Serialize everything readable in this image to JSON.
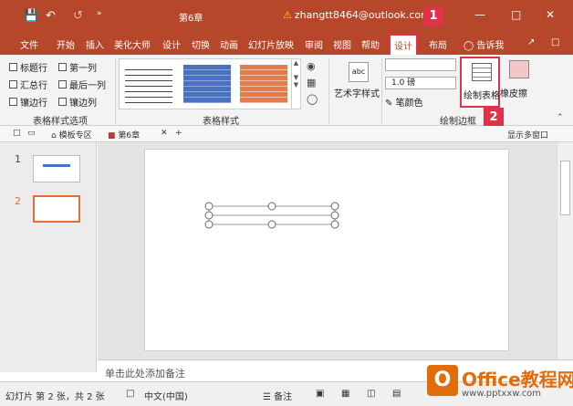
{
  "title_bar": {
    "doc_title": "第6章",
    "account": "zhangtt8464@outlook.com",
    "colors": {
      "accent": "#b7472a",
      "highlight": "#e0334a"
    }
  },
  "tabs": [
    {
      "label": "文件"
    },
    {
      "label": "开始"
    },
    {
      "label": "插入"
    },
    {
      "label": "美化大师"
    },
    {
      "label": "设计"
    },
    {
      "label": "切换"
    },
    {
      "label": "动画"
    },
    {
      "label": "幻灯片放映"
    },
    {
      "label": "审阅"
    },
    {
      "label": "视图"
    },
    {
      "label": "帮助"
    },
    {
      "label": "设计"
    },
    {
      "label": "布局"
    }
  ],
  "tell_me": "告诉我",
  "ribbon": {
    "options": [
      "标题行",
      "第一列",
      "汇总行",
      "最后一列",
      "镶边行",
      "镶边列"
    ],
    "group_options": "表格样式选项",
    "group_styles": "表格样式",
    "wordart": "艺术字样式",
    "pen_weight": "1.0 磅",
    "pen_color": "笔颜色",
    "draw_table": "绘制表格",
    "eraser": "橡皮擦",
    "group_borders": "绘制边框"
  },
  "badges": [
    "1",
    "2"
  ],
  "doc_tabs": {
    "template_zone": "模板专区",
    "file_tab": "第6章",
    "multi_window": "显示多窗口"
  },
  "slides": [
    {
      "num": "1"
    },
    {
      "num": "2"
    }
  ],
  "notes_placeholder": "单击此处添加备注",
  "status": {
    "slide_info": "幻灯片 第 2 张，共 2 张",
    "language": "中文(中国)",
    "notes_btn": "备注"
  },
  "watermark": {
    "logo": "O",
    "brand": "Office教程网",
    "url": "www.pptxxw.com"
  }
}
